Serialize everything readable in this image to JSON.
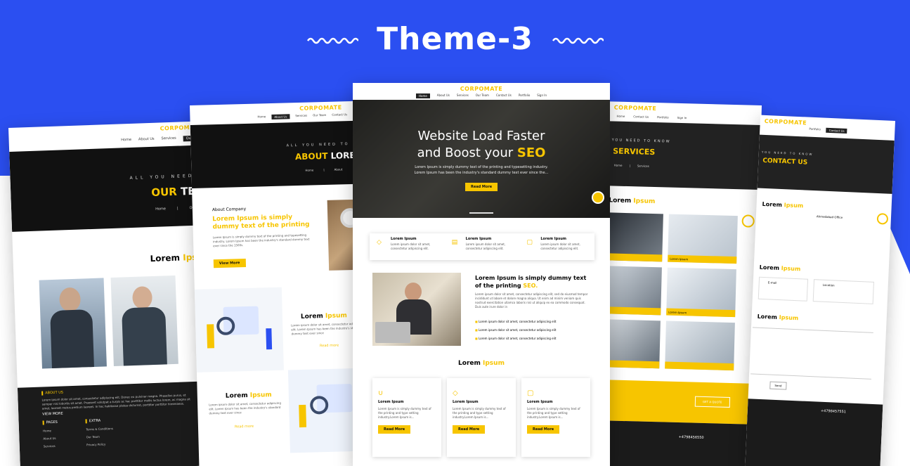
{
  "banner": {
    "title": "Theme-3"
  },
  "brand": "CORPOMATE",
  "colors": {
    "accent": "#f7c500",
    "blue": "#2b4ff1",
    "dark": "#1b1b1b"
  },
  "main": {
    "nav": [
      "Home",
      "About Us",
      "Services",
      "Our Team",
      "Contact Us",
      "Portfolio",
      "Sign In"
    ],
    "hero_line1": "Website Load Faster",
    "hero_line2_a": "and Boost your ",
    "hero_line2_b": "SEO",
    "hero_sub1": "Lorem Ipsum is simply dummy text of the printing and typesetting industry.",
    "hero_sub2": "Lorem Ipsum has been the industry's standard dummy text ever since the...",
    "hero_button": "Read More",
    "features": [
      {
        "title": "Lorem Ipsum",
        "text": "Lorem ipsum dolor sit amet, consectetur adipiscing elit."
      },
      {
        "title": "Lorem Ipsum",
        "text": "Lorem ipsum dolor sit amet, consectetur adipiscing elit."
      },
      {
        "title": "Lorem Ipsum",
        "text": "Lorem ipsum dolor sit amet, consectetur adipiscing elit."
      }
    ],
    "about_h1": "Lorem Ipsum is simply dummy text",
    "about_h2_a": "of the printing ",
    "about_h2_b": "SEO.",
    "about_p": "Lorem ipsum dolor sit amet, consectetur adipiscing elit, sed do eiusmod tempor incididunt ut labore et dolore magna aliqua. Ut enim ad minim veniam quis nostrud exercitation ullamco laboris nisi ut aliquip ex ea commodo consequat. Duis aute irure dolor in",
    "about_bullets": [
      "Lorem ipsum dolor sit amet, consectetur adipiscing elit",
      "Lorem ipsum dolor sit amet, consectetur adipiscing elit",
      "Lorem ipsum dolor sit amet, consectetur adipiscing elit"
    ],
    "section_a": "Lorem ",
    "section_b": "Ipsum",
    "cards": [
      {
        "title": "Lorem Ipsum",
        "text": "Lorem Ipsum is simply dummy text of the printing and type setting industry.Lorem Ipsum is...",
        "button": "Read More"
      },
      {
        "title": "Lorem Ipsum",
        "text": "Lorem Ipsum is simply dummy text of the printing and type setting industry.Lorem Ipsum is...",
        "button": "Read More"
      },
      {
        "title": "Lorem Ipsum",
        "text": "Lorem Ipsum is simply dummy text of the printing and type setting industry.Lorem Ipsum is...",
        "button": "Read More"
      }
    ]
  },
  "team": {
    "nav": [
      "Home",
      "About Us",
      "Services",
      "Our Team"
    ],
    "tagline": "ALL YOU NEED TO",
    "title_a": "OUR ",
    "title_b": "TEA",
    "crumb": [
      "Home",
      "Our T"
    ],
    "section_a": "Lorem ",
    "section_b": "Ipsu",
    "footer_about": "ABOUT US",
    "footer_text": "Lorem ipsum dolor sit amet, consectetur adipiscing elit. Donec eu pulvinar magna. Phasellus purus, et semper nisi lobortis sit amet. Praesent volutpat a turpis ac hac porttitor mollis luctus lorem, ac magna sit amet, laoreet metus pretium laoreet. In hac habitasse platea dictumst, porttitor porttitor himenaeos.",
    "footer_more": "VIEW MORE",
    "pages_title": "PAGES",
    "pages": [
      "Home",
      "About Us",
      "Services"
    ],
    "extra_title": "EXTRA",
    "extra": [
      "Terms & Conditions",
      "Our Team",
      "Privacy Policy"
    ]
  },
  "about": {
    "nav": [
      "Home",
      "About Us",
      "Services",
      "Our Team",
      "Contact Us"
    ],
    "tagline": "ALL YOU NEED TO KNO",
    "title_a": "ABOUT ",
    "title_b": "LOREM",
    "crumb": [
      "Home",
      "About"
    ],
    "company": "About Company",
    "heading": "Lorem Ipsum is simply dummy text of the printing",
    "text": "Lorem Ipsum is simply dummy text of the printing and typesetting industry. Lorem Ipsum has been the industry's standard dummy text ever since the 1500s.",
    "button": "View More",
    "block1_a": "Lorem ",
    "block1_b": "Ipsum",
    "block1_text": "Lorem ipsum dolor sit amet, consectetur adipiscing elit. Lorem Ipsum has been the industry's standard dummy text ever since",
    "block1_link": "Read more",
    "block2_a": "Lorem ",
    "block2_b": "Ipsum",
    "block2_text": "Lorem ipsum dolor sit amet, consectetur adipiscing elit. Lorem Ipsum has been the industry's standard dummy text ever since",
    "block2_link": "Read more"
  },
  "services": {
    "nav": [
      "Home",
      "Contact Us",
      "Portfolio",
      "Sign In"
    ],
    "tagline": "YOU NEED TO KNOW",
    "title": "SERVICES",
    "crumb": [
      "Home",
      "Services"
    ],
    "section_a": "Lorem ",
    "section_b": "Ipsum",
    "tile_label": "Lorem ",
    "tile_label_b": "Ipsum",
    "cta": "GET A QUOTE",
    "phone": "+4798456550"
  },
  "contact": {
    "nav": [
      "Portfolio",
      "Contact Us"
    ],
    "tagline": "YOU NEED TO KNOW",
    "title": "CONTACT US",
    "section_a": "Lorem ",
    "section_b": "Ipsum",
    "office": "Ahmedabad Office",
    "email_label": "E-mail",
    "location_label": "Location",
    "send": "Send",
    "phone": "+4798457551"
  }
}
